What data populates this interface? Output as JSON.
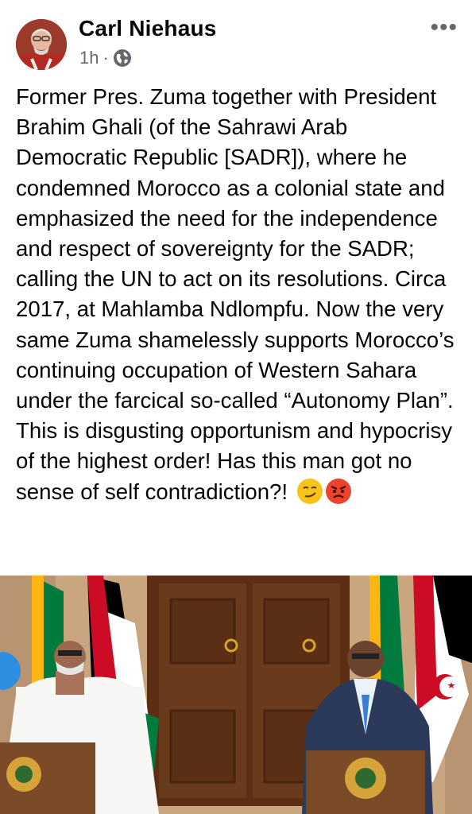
{
  "post": {
    "author": "Carl Niehaus",
    "time": "1h",
    "separator": "·",
    "privacy_icon": "globe-icon",
    "more_icon": "more-options-icon",
    "more_label": "•••",
    "text": "Former Pres. Zuma together with President Brahim Ghali (of the Sahrawi Arab Democratic Republic [SADR]), where he condemned Morocco as a colonial state and emphasized the need for the independence and respect of sovereignty for the SADR; calling the UN to act on its resolutions. Circa 2017, at Mahlamba Ndlompfu. Now the very same Zuma shamelessly supports Morocco’s continuing occupation of Western Sahara under the farcical so-called “Autonomy Plan”. This is disgusting opportunism and hypocrisy of the highest order! Has this man got no sense of self contradiction?!",
    "emojis": [
      "smirking-face-emoji",
      "angry-face-emoji"
    ]
  },
  "colors": {
    "text": "#050505",
    "secondary": "#65676b",
    "sahrawi_red": "#cc0b24",
    "sa_green": "#007a3d",
    "wood": "#6a3a1c"
  }
}
